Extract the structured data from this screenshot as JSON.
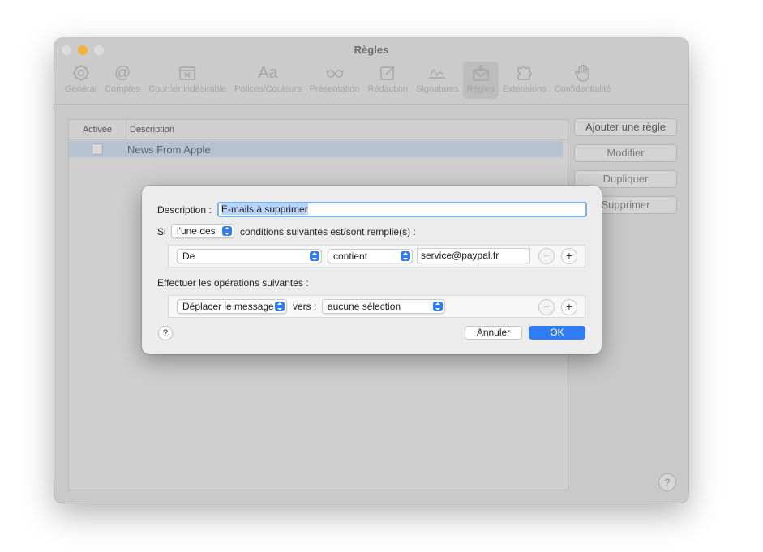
{
  "window": {
    "title": "Règles",
    "toolbar": [
      {
        "label": "Général",
        "icon": "gear-icon"
      },
      {
        "label": "Comptes",
        "icon": "at-icon"
      },
      {
        "label": "Courrier indésirable",
        "icon": "junk-mail-icon"
      },
      {
        "label": "Polices/Couleurs",
        "icon": "fonts-icon"
      },
      {
        "label": "Présentation",
        "icon": "glasses-icon"
      },
      {
        "label": "Rédaction",
        "icon": "compose-icon"
      },
      {
        "label": "Signatures",
        "icon": "signature-icon"
      },
      {
        "label": "Règles",
        "icon": "rules-icon"
      },
      {
        "label": "Extensions",
        "icon": "puzzle-icon"
      },
      {
        "label": "Confidentialité",
        "icon": "hand-icon"
      }
    ]
  },
  "rules_list": {
    "headers": {
      "enabled": "Activée",
      "description": "Description"
    },
    "rows": [
      {
        "enabled": false,
        "description": "News From Apple"
      }
    ]
  },
  "side_buttons": {
    "add": "Ajouter une règle",
    "edit": "Modifier",
    "duplicate": "Dupliquer",
    "delete": "Supprimer"
  },
  "help_label": "?",
  "sheet": {
    "description_label": "Description :",
    "description_value": "E-mails à supprimer",
    "if_label": "Si",
    "match_popup": "l'une des",
    "conditions_text": "conditions suivantes est/sont remplie(s) :",
    "condition": {
      "field": "De",
      "operator": "contient",
      "value": "service@paypal.fr"
    },
    "actions_label": "Effectuer les opérations suivantes :",
    "action": {
      "type": "Déplacer le message",
      "to_label": "vers :",
      "target": "aucune sélection"
    },
    "remove_symbol": "−",
    "add_symbol": "+",
    "cancel_label": "Annuler",
    "ok_label": "OK",
    "help_label": "?"
  }
}
